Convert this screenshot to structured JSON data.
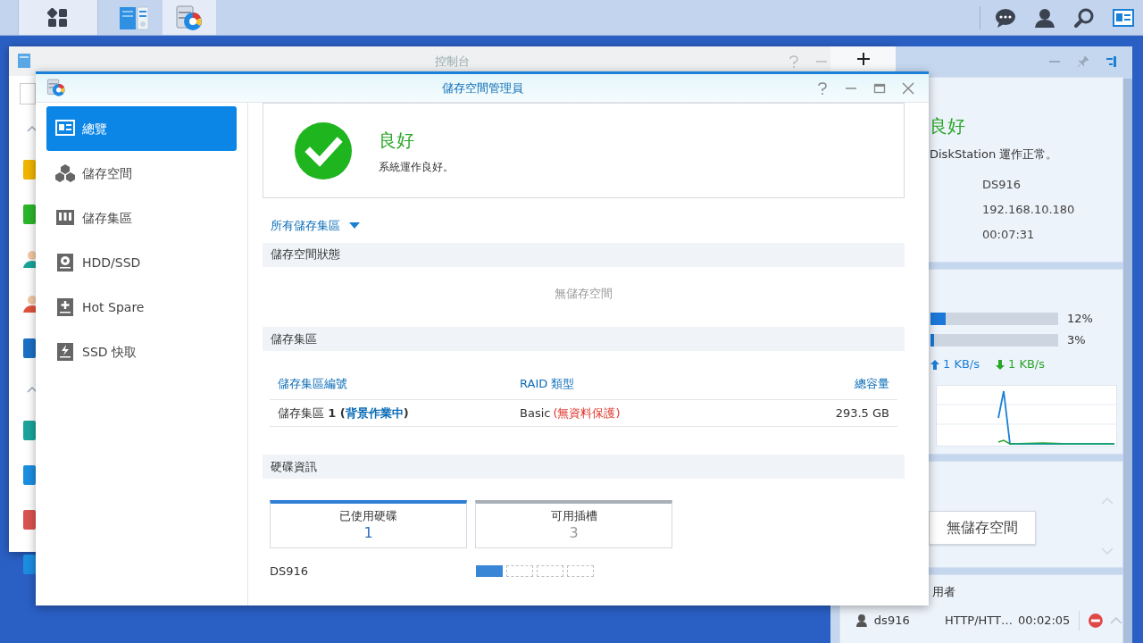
{
  "taskbar": {
    "apps": [
      {
        "kind": "main-menu",
        "selected": true
      },
      {
        "kind": "control-panel",
        "selected": false
      },
      {
        "kind": "storage-manager",
        "selected": true
      }
    ],
    "tray": [
      {
        "kind": "chat",
        "selected": false
      },
      {
        "kind": "user",
        "selected": false
      },
      {
        "kind": "search",
        "selected": false
      },
      {
        "kind": "widgets",
        "selected": true
      }
    ]
  },
  "background_window": {
    "title": "控制台",
    "side_icons": [
      {
        "kind": "home"
      },
      {
        "kind": "chevron"
      },
      {
        "kind": "app",
        "color": "#f0b400"
      },
      {
        "kind": "app",
        "color": "#2bb52b"
      },
      {
        "kind": "person",
        "color": "#1aa39a"
      },
      {
        "kind": "person",
        "color": "#e0533c"
      },
      {
        "kind": "app",
        "color": "#1b6fc4"
      },
      {
        "kind": "chevron"
      },
      {
        "kind": "app",
        "color": "#1aa39a"
      },
      {
        "kind": "app",
        "color": "#1b8ee0"
      },
      {
        "kind": "app",
        "color": "#d9534f"
      },
      {
        "kind": "app",
        "color": "#1b8ee0"
      }
    ]
  },
  "window": {
    "title": "儲存空間管理員",
    "sidebar": [
      {
        "label": "總覽",
        "kind": "overview",
        "selected": true
      },
      {
        "label": "儲存空間",
        "kind": "cubes",
        "selected": false
      },
      {
        "label": "儲存集區",
        "kind": "pool",
        "selected": false
      },
      {
        "label": "HDD/SSD",
        "kind": "disk",
        "selected": false
      },
      {
        "label": "Hot Spare",
        "kind": "spare",
        "selected": false
      },
      {
        "label": "SSD 快取",
        "kind": "cache",
        "selected": false
      }
    ],
    "health": {
      "status": "良好",
      "message": "系統運作良好。"
    },
    "filter": "所有儲存集區",
    "volume_status": {
      "heading": "儲存空間狀態",
      "empty_text": "無儲存空間"
    },
    "pools": {
      "heading": "儲存集區",
      "columns": [
        "儲存集區編號",
        "RAID 類型",
        "總容量"
      ],
      "rows": [
        {
          "name": "儲存集區 **1 (**",
          "status": "背景作業中",
          "name_end": "**)**",
          "raid": "Basic",
          "raid_note": "(無資料保護)",
          "capacity": "293.5 GB"
        }
      ]
    },
    "disk_info": {
      "heading": "硬碟資訊",
      "tiles": [
        {
          "label": "已使用硬碟",
          "value": "1",
          "kind": "used"
        },
        {
          "label": "可用插槽",
          "value": "3",
          "kind": "free"
        }
      ],
      "device": "DS916",
      "slots": [
        {
          "used": true
        },
        {
          "used": false
        },
        {
          "used": false
        },
        {
          "used": false
        }
      ]
    }
  },
  "widgets": {
    "health": {
      "status": "良好",
      "message": "DiskStation 運作正常。",
      "values": [
        "DS916",
        "192.168.10.180",
        "00:07:31"
      ]
    },
    "resource": {
      "meters": [
        {
          "level": 0.12,
          "reading": "12%"
        },
        {
          "level": 0.03,
          "reading": "3%"
        }
      ],
      "upload": "1 KB/s",
      "download": "1 KB/s"
    },
    "storage": {
      "text": "無儲存空間"
    },
    "users": {
      "title": "用者",
      "rows": [
        {
          "name": "ds916",
          "protocol": "HTTP/HTT…",
          "time": "00:02:05"
        }
      ]
    }
  }
}
